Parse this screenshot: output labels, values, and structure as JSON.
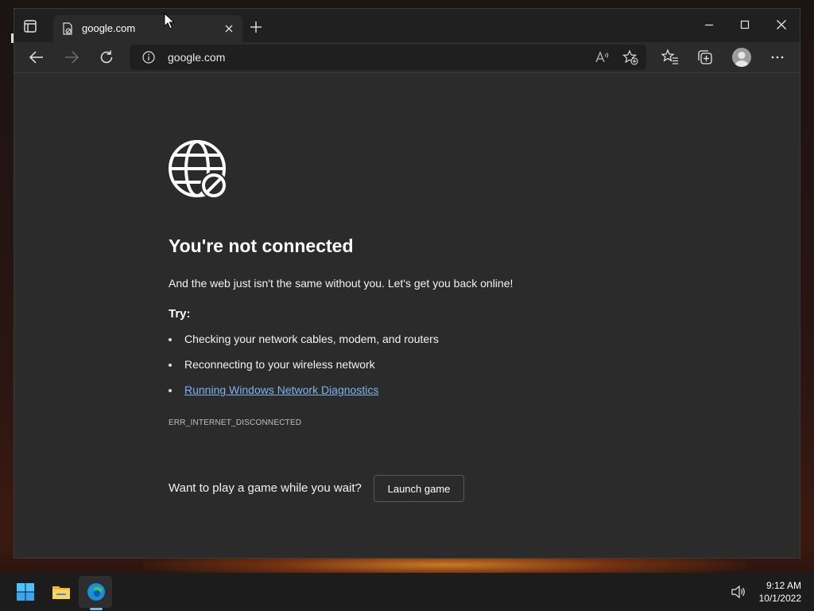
{
  "browser": {
    "tab": {
      "title": "google.com"
    },
    "address_bar": {
      "url": "google.com"
    }
  },
  "error_page": {
    "heading": "You're not connected",
    "subtitle": "And the web just isn't the same without you. Let's get you back online!",
    "try_label": "Try:",
    "suggestions": [
      "Checking your network cables, modem, and routers",
      "Reconnecting to your wireless network",
      "Running Windows Network Diagnostics"
    ],
    "error_code": "ERR_INTERNET_DISCONNECTED",
    "game_prompt": "Want to play a game while you wait?",
    "game_button": "Launch game"
  },
  "taskbar": {
    "time": "9:12 AM",
    "date": "10/1/2022"
  },
  "icons": {
    "tab_actions": "tab-actions-icon",
    "favicon": "offline-page-icon",
    "back": "back-arrow-icon",
    "forward": "forward-arrow-icon",
    "refresh": "refresh-icon",
    "site_info": "info-icon",
    "read_aloud": "read-aloud-icon",
    "add_favorite": "add-favorite-icon",
    "favorites": "favorites-icon",
    "collections": "collections-icon",
    "profile": "profile-avatar",
    "menu": "more-options-icon",
    "error": "globe-blocked-icon",
    "start": "windows-start-icon",
    "explorer": "file-explorer-icon",
    "edge": "edge-browser-icon",
    "volume": "volume-icon"
  },
  "colors": {
    "link": "#7bb4f0",
    "page_bg": "#2b2b2b",
    "tabstrip_bg": "#202020",
    "taskbar_bg": "#1c1c1c",
    "edge_indicator": "#76b9ed"
  }
}
